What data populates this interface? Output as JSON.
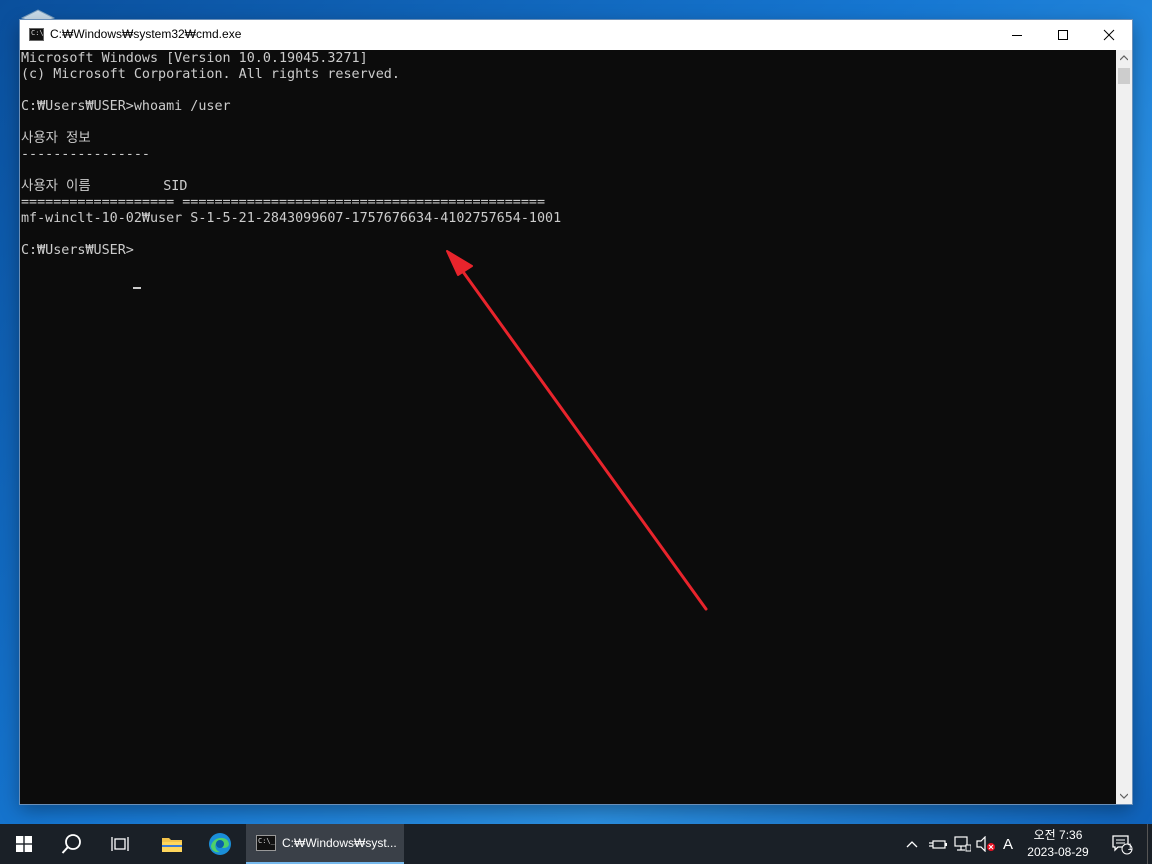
{
  "window": {
    "title": "C:\\Windows\\system32\\cmd.exe",
    "title_display": "C:₩Windows₩system32₩cmd.exe"
  },
  "console": {
    "lines": [
      "Microsoft Windows [Version 10.0.19045.3271]",
      "(c) Microsoft Corporation. All rights reserved.",
      "",
      "C:₩Users₩USER>whoami /user",
      "",
      "사용자 정보",
      "----------------",
      "",
      "사용자 이름         SID",
      "=================== =============================================",
      "mf-winclt-10-02₩user S-1-5-21-2843099607-1757676634-4102757654-1001",
      "",
      "C:₩Users₩USER>"
    ]
  },
  "taskbar": {
    "cmd_label": "C:₩Windows₩syst...",
    "ime_label": "A",
    "clock_time": "오전 7:36",
    "clock_date": "2023-08-29",
    "notification_count": "1"
  },
  "icons": {
    "start": "windows-logo-icon",
    "search": "search-icon",
    "task_view": "task-view-icon",
    "explorer": "folder-icon",
    "edge": "edge-icon",
    "cmd": "cmd-icon"
  },
  "colors": {
    "console_bg": "#0c0c0c",
    "console_fg": "#cccccc",
    "annotation_arrow": "#e8242c",
    "taskbar_bg": "#1a2027"
  }
}
